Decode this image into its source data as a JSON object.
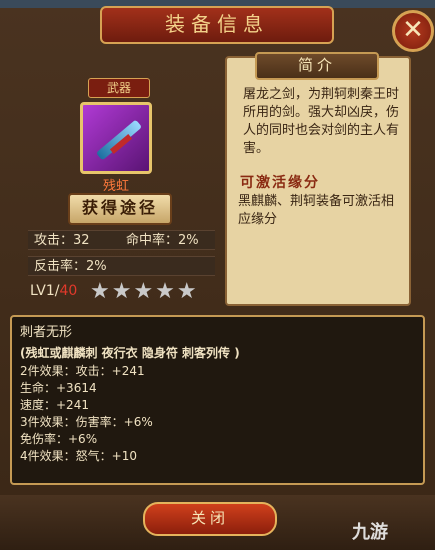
{
  "title": "装备信息",
  "close_icon": "close-x-icon",
  "item": {
    "category": "武器",
    "name": "残虹",
    "obtain_label": "获得途径",
    "stats": [
      {
        "label": "攻击",
        "value": "32"
      },
      {
        "label": "命中率",
        "value": "2%"
      },
      {
        "label": "反击率",
        "value": "2%"
      }
    ],
    "level_current": "LV1/",
    "level_max": "40",
    "stars": "★★★★★"
  },
  "intro": {
    "heading": "简介",
    "text": "屠龙之剑，为荆轲刺秦王时所用的剑。强大却凶戾，伤人的同时也会对剑的主人有害。",
    "combo_heading": "可激活缘分",
    "combo_text": "黑麒麟、荆轲装备可激活相应缘分"
  },
  "set": {
    "name": "刺者无形",
    "pieces": "(残虹或麒麟刺 夜行衣 隐身符 刺客列传 )",
    "lines": [
      "2件效果：攻击：+241",
      "生命：+3614",
      "速度：+241",
      "3件效果：伤害率：+6%",
      "免伤率：+6%",
      "4件效果：怒气：+10"
    ]
  },
  "close_button": "关闭",
  "watermark": "九游"
}
